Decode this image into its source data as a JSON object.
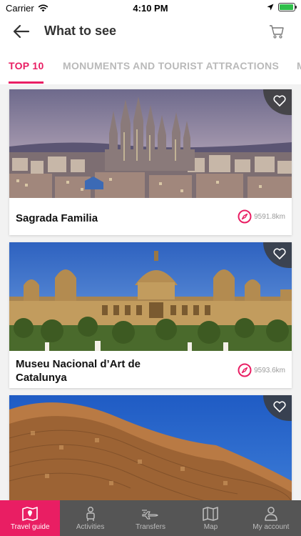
{
  "status_bar": {
    "carrier": "Carrier",
    "time": "4:10 PM",
    "battery_level": 0.95
  },
  "header": {
    "title": "What to see"
  },
  "tabs": [
    {
      "label": "TOP 10"
    },
    {
      "label": "MONUMENTS AND TOURIST ATTRACTIONS"
    },
    {
      "label": "M"
    }
  ],
  "cards": [
    {
      "name": "Sagrada Familia",
      "distance": "9591.8km"
    },
    {
      "name": "Museu Nacional d’Art de Catalunya",
      "distance": "9593.6km"
    },
    {
      "name": "",
      "distance": ""
    }
  ],
  "tabbar": [
    {
      "label": "Travel guide",
      "icon": "map-book-icon"
    },
    {
      "label": "Activities",
      "icon": "person-icon"
    },
    {
      "label": "Transfers",
      "icon": "plane-icon"
    },
    {
      "label": "Map",
      "icon": "map-icon"
    },
    {
      "label": "My account",
      "icon": "user-icon"
    }
  ],
  "colors": {
    "accent": "#e91e63",
    "tabbar_bg": "#555555",
    "inactive_tab": "#b9b9b9"
  }
}
